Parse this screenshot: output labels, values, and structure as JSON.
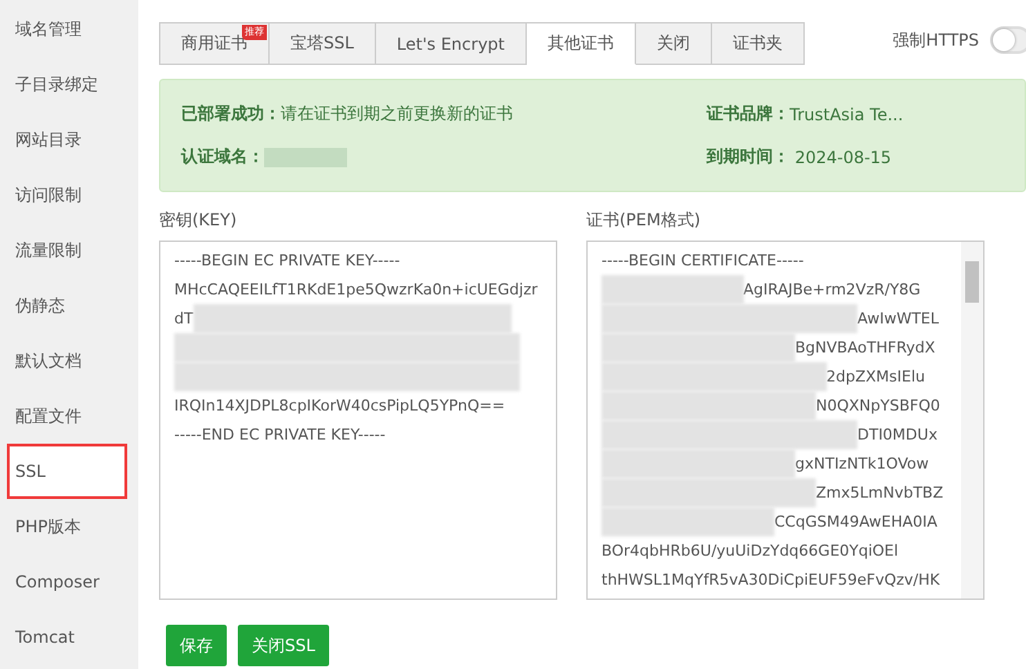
{
  "sidebar": {
    "items": [
      {
        "label": "域名管理",
        "selected": false
      },
      {
        "label": "子目录绑定",
        "selected": false
      },
      {
        "label": "网站目录",
        "selected": false
      },
      {
        "label": "访问限制",
        "selected": false
      },
      {
        "label": "流量限制",
        "selected": false
      },
      {
        "label": "伪静态",
        "selected": false
      },
      {
        "label": "默认文档",
        "selected": false
      },
      {
        "label": "配置文件",
        "selected": false
      },
      {
        "label": "SSL",
        "selected": true
      },
      {
        "label": "PHP版本",
        "selected": false
      },
      {
        "label": "Composer",
        "selected": false
      },
      {
        "label": "Tomcat",
        "selected": false
      }
    ]
  },
  "tabs": [
    {
      "label": "商用证书",
      "selected": false,
      "badge": "推荐"
    },
    {
      "label": "宝塔SSL",
      "selected": false
    },
    {
      "label": "Let's Encrypt",
      "selected": false
    },
    {
      "label": "其他证书",
      "selected": true
    },
    {
      "label": "关闭",
      "selected": false
    },
    {
      "label": "证书夹",
      "selected": false
    }
  ],
  "force_https": {
    "label": "强制HTTPS",
    "on": false
  },
  "status": {
    "deployed_label": "已部署成功：",
    "deployed_text": "请在证书到期之前更换新的证书",
    "domain_label": "认证域名：",
    "brand_label": "证书品牌：",
    "brand_value": "TrustAsia Te...",
    "expiry_label": "到期时间：",
    "expiry_value": "2024-08-15"
  },
  "key": {
    "label": "密钥(KEY)",
    "lines": [
      {
        "kind": "text",
        "text": "-----BEGIN EC PRIVATE KEY-----"
      },
      {
        "kind": "text",
        "text": "MHcCAQEEILfT1RKdE1pe5QwzrKa0n+icUEGdjzr"
      },
      {
        "kind": "masked_suffix",
        "text": "dT"
      },
      {
        "kind": "masked"
      },
      {
        "kind": "masked"
      },
      {
        "kind": "text",
        "text": "IRQIn14XJDPL8cpIKorW40csPipLQ5YPnQ=="
      },
      {
        "kind": "text",
        "text": "-----END EC PRIVATE KEY-----"
      }
    ]
  },
  "certificate": {
    "label": "证书(PEM格式)",
    "lines": [
      {
        "kind": "text",
        "text": "-----BEGIN CERTIFICATE-----"
      },
      {
        "kind": "masked_prefix",
        "text": "AgIRAJBe+rm2VzR/Y8G"
      },
      {
        "kind": "masked_prefix",
        "text": "AwIwWTEL"
      },
      {
        "kind": "masked_prefix",
        "text": "BgNVBAoTHFRydX"
      },
      {
        "kind": "masked_prefix",
        "text": "2dpZXMsIElu"
      },
      {
        "kind": "masked_prefix",
        "text": "N0QXNpYSBFQ0"
      },
      {
        "kind": "masked_prefix",
        "text": "DTI0MDUx"
      },
      {
        "kind": "masked_prefix",
        "text": "gxNTIzNTk1OVow"
      },
      {
        "kind": "masked_prefix",
        "text": "Zmx5LmNvbTBZ"
      },
      {
        "kind": "masked_prefix",
        "text": "CCqGSM49AwEHA0IA"
      },
      {
        "kind": "text",
        "text": "BOr4qbHRb6U/yuUiDzYdq66GE0YqiOEl"
      },
      {
        "kind": "text",
        "text": "thHWSL1MqYfR5vA30DiCpiEUF59eFvQzv/HK"
      }
    ]
  },
  "buttons": [
    {
      "label": "保存"
    },
    {
      "label": "关闭SSL"
    }
  ]
}
